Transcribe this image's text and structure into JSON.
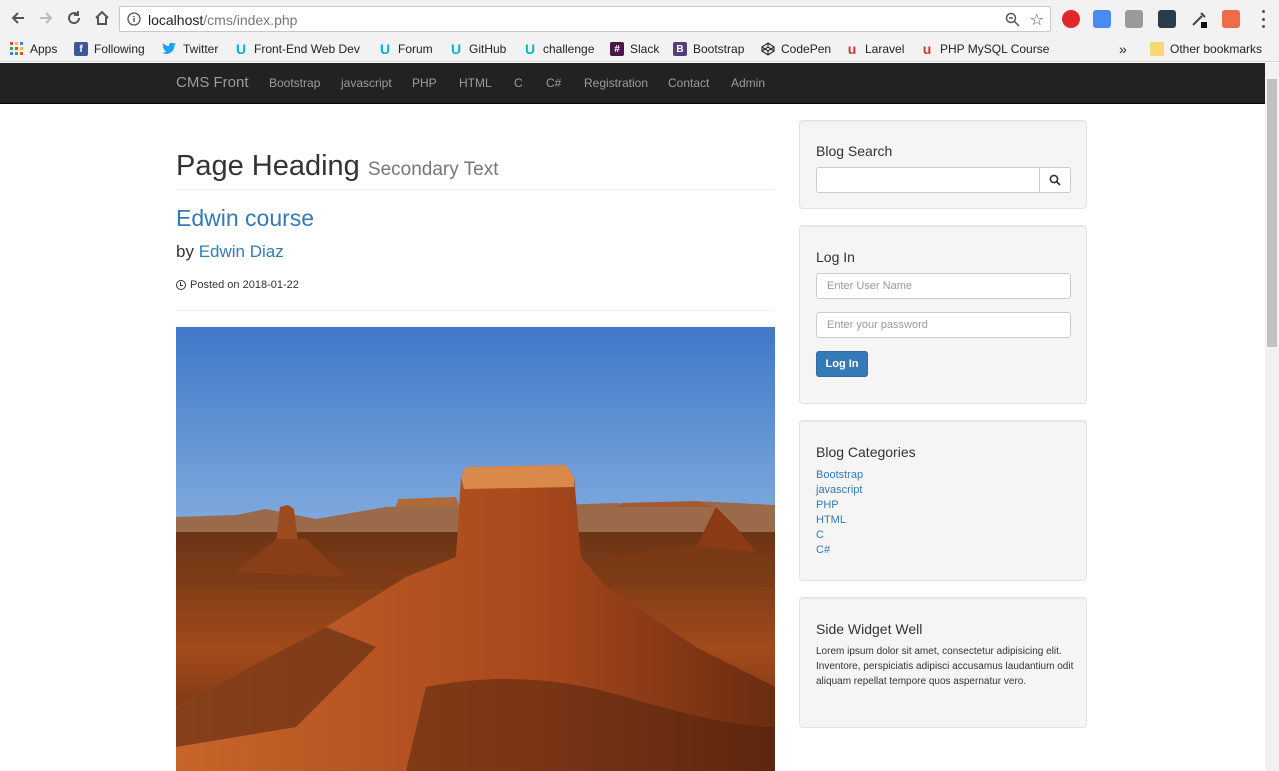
{
  "browser": {
    "url_host": "localhost",
    "url_path": "/cms/index.php",
    "bookmarks": [
      {
        "label": "Apps",
        "icon": "apps-grid-icon",
        "color": "#e8453c"
      },
      {
        "label": "Following",
        "icon": "facebook-icon",
        "color": "#3b5998"
      },
      {
        "label": "Twitter",
        "icon": "twitter-icon",
        "color": "#1da1f2"
      },
      {
        "label": "Front-End Web Dev",
        "icon": "udemy-icon",
        "color": "#00b4d8"
      },
      {
        "label": "Forum",
        "icon": "udemy-icon",
        "color": "#00b4d8"
      },
      {
        "label": "GitHub",
        "icon": "udemy-icon",
        "color": "#00b4d8"
      },
      {
        "label": "challenge",
        "icon": "udemy-icon",
        "color": "#00b4d8"
      },
      {
        "label": "Slack",
        "icon": "slack-icon",
        "color": "#4a154b"
      },
      {
        "label": "Bootstrap",
        "icon": "bootstrap-icon",
        "color": "#563d7c"
      },
      {
        "label": "CodePen",
        "icon": "codepen-icon",
        "color": "#222222"
      },
      {
        "label": "Laravel",
        "icon": "laravel-icon",
        "color": "#d0343a"
      },
      {
        "label": "PHP MySQL Course",
        "icon": "udemy-icon",
        "color": "#d0343a"
      }
    ],
    "overflow_label": "»",
    "other_bookmarks": "Other bookmarks"
  },
  "navbar": {
    "brand": "CMS Front",
    "links": [
      "Bootstrap",
      "javascript",
      "PHP",
      "HTML",
      "C",
      "C#",
      "Registration",
      "Contact",
      "Admin"
    ]
  },
  "main": {
    "page_heading": "Page Heading",
    "page_subheading": "Secondary Text",
    "post_title": "Edwin course",
    "by_label": "by",
    "author": "Edwin Diaz",
    "posted_on": "Posted on 2018-01-22"
  },
  "sidebar": {
    "search_title": "Blog Search",
    "login_title": "Log In",
    "username_placeholder": "Enter User Name",
    "password_placeholder": "Enter your password",
    "login_button": "Log In",
    "categories_title": "Blog Categories",
    "categories": [
      "Bootstrap",
      "javascript",
      "PHP",
      "HTML",
      "C",
      "C#"
    ],
    "widget_title": "Side Widget Well",
    "widget_text": "Lorem ipsum dolor sit amet, consectetur adipisicing elit. Inventore, perspiciatis adipisci accusamus laudantium odit aliquam repellat tempore quos aspernatur vero."
  },
  "colors": {
    "link": "#337ab7",
    "navbar_bg": "#222222",
    "well_bg": "#f5f5f5"
  }
}
